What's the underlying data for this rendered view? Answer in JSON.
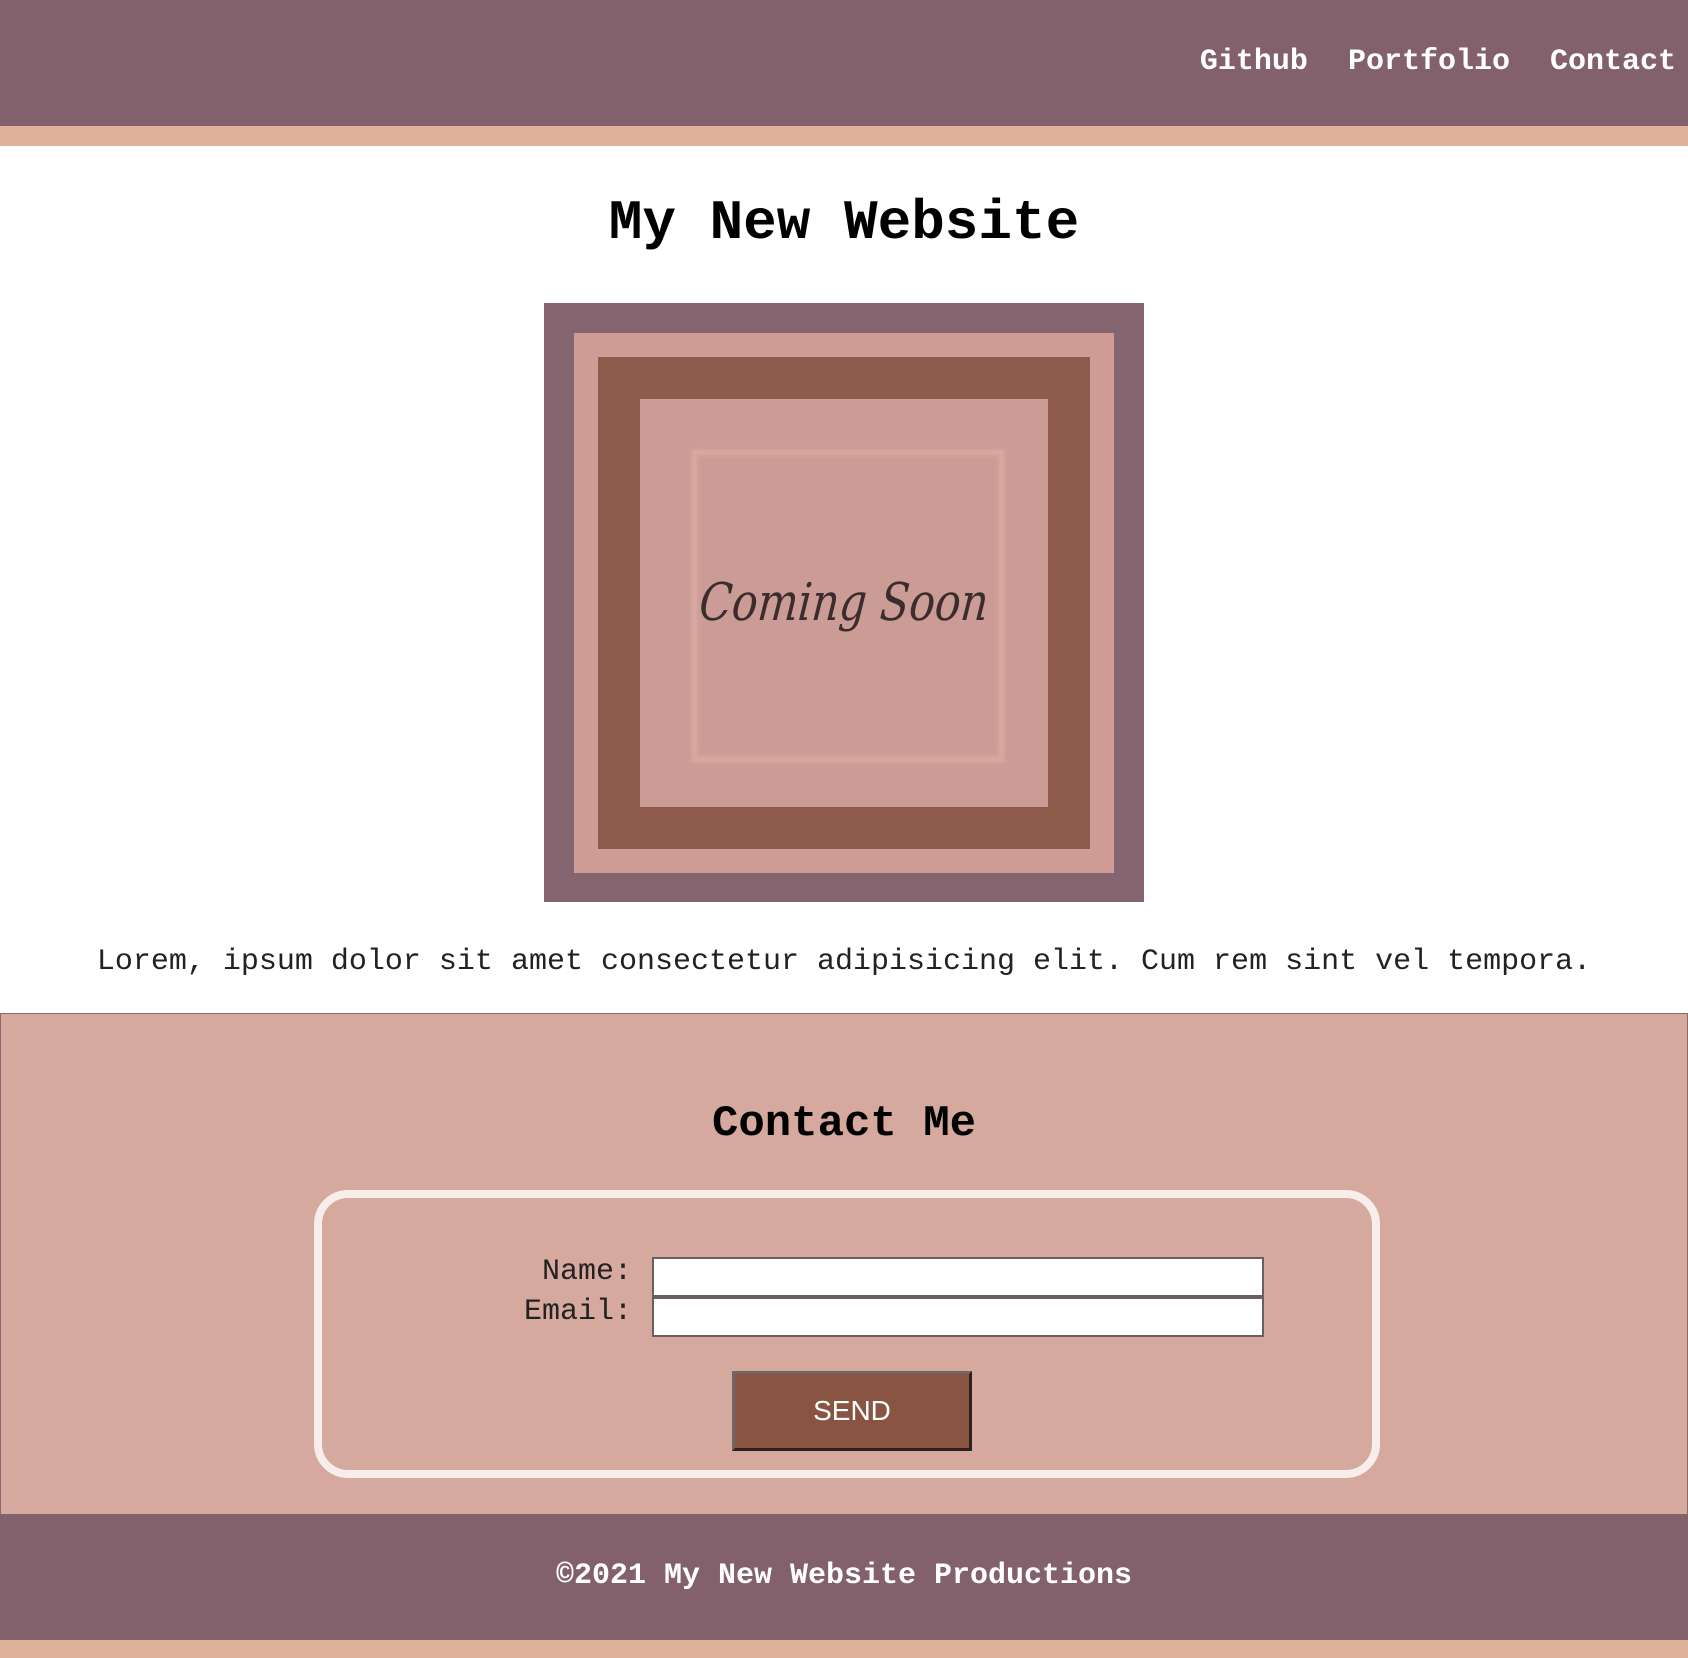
{
  "nav": {
    "items": [
      {
        "label": "Github"
      },
      {
        "label": "Portfolio"
      },
      {
        "label": "Contact"
      }
    ]
  },
  "main": {
    "title": "My New Website",
    "hero_text": "Coming Soon",
    "intro": "Lorem, ipsum dolor sit amet consectetur adipisicing elit. Cum rem sint vel tempora."
  },
  "contact": {
    "title": "Contact Me",
    "name_label": "Name:",
    "name_value": "",
    "email_label": "Email:",
    "email_value": "",
    "send_label": "SEND"
  },
  "footer": {
    "text": "©2021 My New Website Productions"
  },
  "colors": {
    "header_bg": "#83616c",
    "stripe": "#deb199",
    "contact_bg": "#d5a99d",
    "button_bg": "#8a5443",
    "form_border": "#f7eeeb"
  }
}
